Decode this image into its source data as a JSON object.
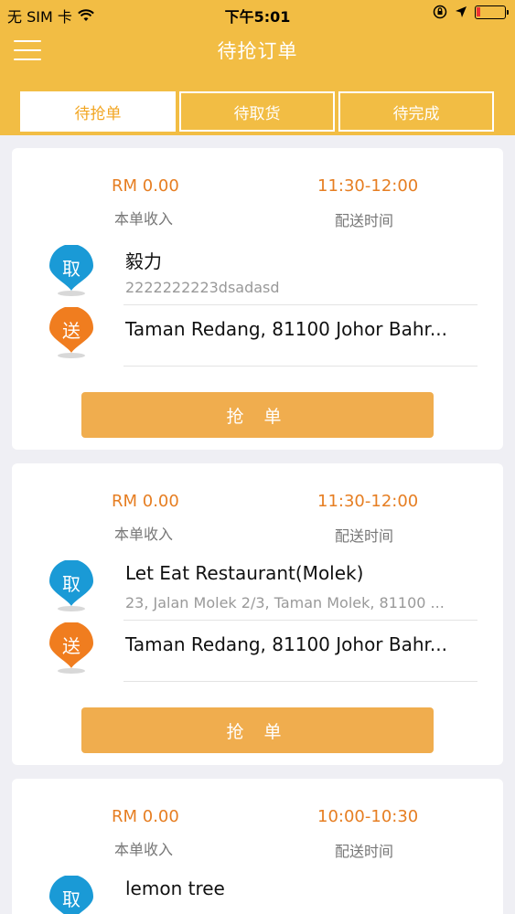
{
  "status_bar": {
    "carrier": "无 SIM 卡",
    "time": "下午5:01"
  },
  "nav": {
    "title": "待抢订单",
    "menu_icon": "hamburger-menu-icon"
  },
  "tabs": [
    {
      "label": "待抢单",
      "active": true
    },
    {
      "label": "待取货",
      "active": false
    },
    {
      "label": "待完成",
      "active": false
    }
  ],
  "colors": {
    "header": "#f2bd44",
    "accent": "#e67e22",
    "button": "#f0ad4e",
    "pickup_pin": "#1a9ad6",
    "delivery_pin": "#f07d1f"
  },
  "labels": {
    "income": "本单收入",
    "delivery_time": "配送时间",
    "pickup_badge": "取",
    "delivery_badge": "送",
    "grab_button": "抢 单"
  },
  "orders": [
    {
      "amount": "RM 0.00",
      "time": "11:30-12:00",
      "pickup_name": "毅力",
      "pickup_address": "2222222223dsadasd",
      "delivery_address": "Taman Redang, 81100 Johor Bahr..."
    },
    {
      "amount": "RM 0.00",
      "time": "11:30-12:00",
      "pickup_name": "Let Eat Restaurant(Molek)",
      "pickup_address": "23, Jalan Molek 2/3, Taman Molek, 81100 ...",
      "delivery_address": "Taman Redang, 81100 Johor Bahr..."
    },
    {
      "amount": "RM 0.00",
      "time": "10:00-10:30",
      "pickup_name": "lemon tree",
      "pickup_address": "",
      "delivery_address": ""
    }
  ]
}
